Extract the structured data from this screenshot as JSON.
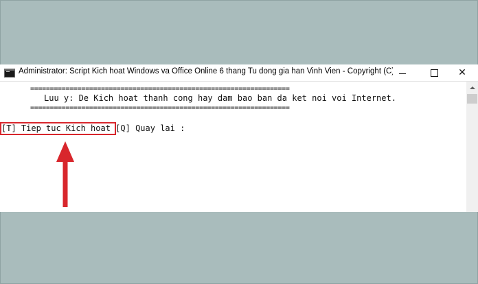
{
  "window": {
    "title": "Administrator:  Script Kich hoat Windows va Office Online 6 thang Tu dong gia han Vinh Vien - Copyright (C) ...",
    "controls": {
      "minimize": "",
      "maximize": "",
      "close": "✕"
    }
  },
  "console": {
    "separator": "==================================================================",
    "note": "Luu y: De Kich hoat thanh cong hay dam bao ban da ket noi voi Internet.",
    "prompt": "[T] Tiep tuc Kich hoat [Q] Quay lai :"
  },
  "colors": {
    "background": "#a9bcbc",
    "highlight": "#d8262c",
    "arrow": "#d8262c"
  },
  "icons": {
    "app": "console-icon",
    "arrow": "up-arrow-icon",
    "scroll_up": "triangle-up-icon"
  }
}
